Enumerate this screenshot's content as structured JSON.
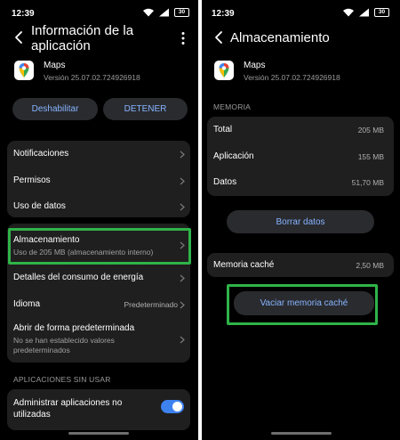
{
  "colors": {
    "accent_text": "#86b4ff",
    "highlight": "#2fb348",
    "toggle_on": "#3e82f0",
    "card": "#1f1f1f"
  },
  "left": {
    "status": {
      "time": "12:39",
      "battery": "30"
    },
    "header": {
      "title_line1": "Información de la",
      "title_line2": "aplicación"
    },
    "app": {
      "name": "Maps",
      "version": "Versión 25.07.02.724926918"
    },
    "buttons": {
      "disable": "Deshabilitar",
      "stop": "DETENER"
    },
    "menu": {
      "notifications": "Notificaciones",
      "permissions": "Permisos",
      "data_usage": "Uso de datos",
      "storage": "Almacenamiento",
      "storage_sub": "Uso de 205 MB (almacenamiento interno)",
      "energy": "Detalles del consumo de energía",
      "language": "Idioma",
      "language_value": "Predeterminado",
      "default_open": "Abrir de forma predeterminada",
      "default_open_sub1": "No se han establecido valores",
      "default_open_sub2": "predeterminados"
    },
    "unused": {
      "section": "APLICACIONES SIN USAR",
      "manage_line1": "Administrar aplicaciones no",
      "manage_line2": "utilizadas",
      "toggle_on": true
    }
  },
  "right": {
    "status": {
      "time": "12:39",
      "battery": "30"
    },
    "header": {
      "title": "Almacenamiento"
    },
    "app": {
      "name": "Maps",
      "version": "Versión 25.07.02.724926918"
    },
    "memory": {
      "section": "MEMORIA",
      "rows": [
        {
          "label": "Total",
          "value": "205 MB"
        },
        {
          "label": "Aplicación",
          "value": "155 MB"
        },
        {
          "label": "Datos",
          "value": "51,70 MB"
        }
      ]
    },
    "clear_data": "Borrar datos",
    "cache": {
      "label": "Memoria caché",
      "value": "2,50 MB"
    },
    "clear_cache": "Vaciar memoria caché"
  }
}
